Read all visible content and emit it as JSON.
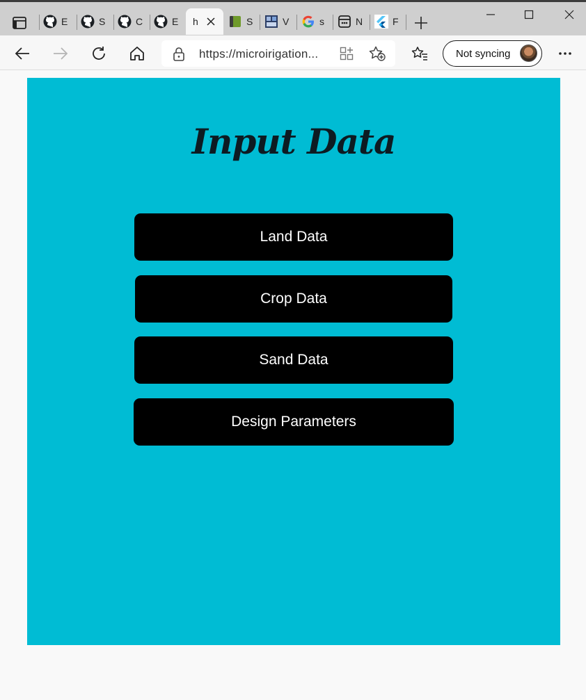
{
  "browser": {
    "tabs": [
      {
        "title": "E",
        "icon": "github-icon"
      },
      {
        "title": "S",
        "icon": "github-icon"
      },
      {
        "title": "C",
        "icon": "github-icon"
      },
      {
        "title": "E",
        "icon": "github-icon"
      },
      {
        "title": "h",
        "icon": "none",
        "active": true
      },
      {
        "title": "S",
        "icon": "green-book-icon"
      },
      {
        "title": "V",
        "icon": "video-app-icon"
      },
      {
        "title": "s",
        "icon": "google-icon"
      },
      {
        "title": "N",
        "icon": "app-window-icon"
      },
      {
        "title": "F",
        "icon": "flutter-icon"
      }
    ],
    "url": "https://microirigation...",
    "sync_label": "Not syncing"
  },
  "page": {
    "title": "Input Data",
    "buttons": [
      {
        "label": "Land Data"
      },
      {
        "label": "Crop Data"
      },
      {
        "label": "Sand Data"
      },
      {
        "label": "Design Parameters"
      }
    ]
  },
  "colors": {
    "panel": "#00bcd4",
    "button": "#000000",
    "button_text": "#ffffff",
    "title": "#0d1b22"
  }
}
